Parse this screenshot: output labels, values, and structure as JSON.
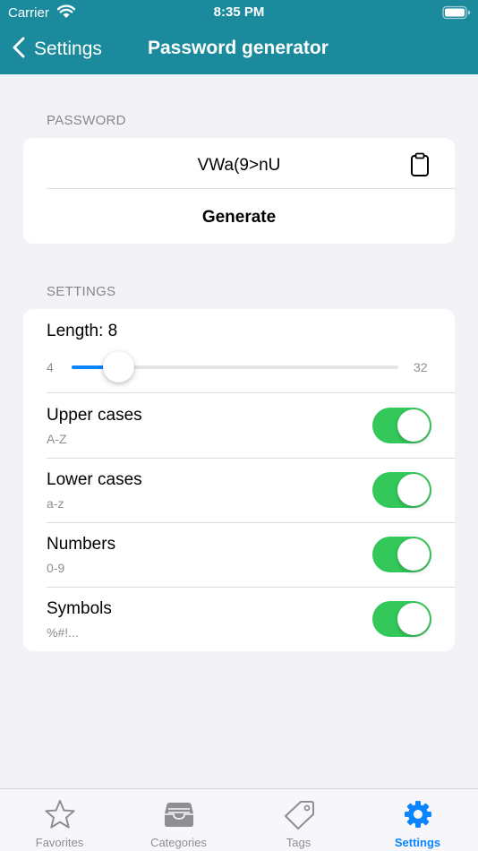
{
  "status_bar": {
    "carrier": "Carrier",
    "time": "8:35 PM"
  },
  "nav": {
    "back_label": "Settings",
    "title": "Password generator"
  },
  "password_section": {
    "header": "PASSWORD",
    "value": "VWa(9>nU",
    "generate_label": "Generate"
  },
  "settings_section": {
    "header": "SETTINGS",
    "length_label": "Length: 8",
    "slider": {
      "min": "4",
      "max": "32",
      "value": 8
    },
    "options": [
      {
        "title": "Upper cases",
        "subtitle": "A-Z",
        "enabled": true
      },
      {
        "title": "Lower cases",
        "subtitle": "a-z",
        "enabled": true
      },
      {
        "title": "Numbers",
        "subtitle": "0-9",
        "enabled": true
      },
      {
        "title": "Symbols",
        "subtitle": "%#!...",
        "enabled": true
      }
    ]
  },
  "tabs": [
    {
      "label": "Favorites",
      "icon": "star-icon",
      "active": false
    },
    {
      "label": "Categories",
      "icon": "tray-icon",
      "active": false
    },
    {
      "label": "Tags",
      "icon": "tag-icon",
      "active": false
    },
    {
      "label": "Settings",
      "icon": "gear-icon",
      "active": true
    }
  ],
  "colors": {
    "header_bg": "#1b8a9c",
    "accent": "#0a84ff",
    "toggle_on": "#34c759",
    "background": "#f2f2f7"
  }
}
